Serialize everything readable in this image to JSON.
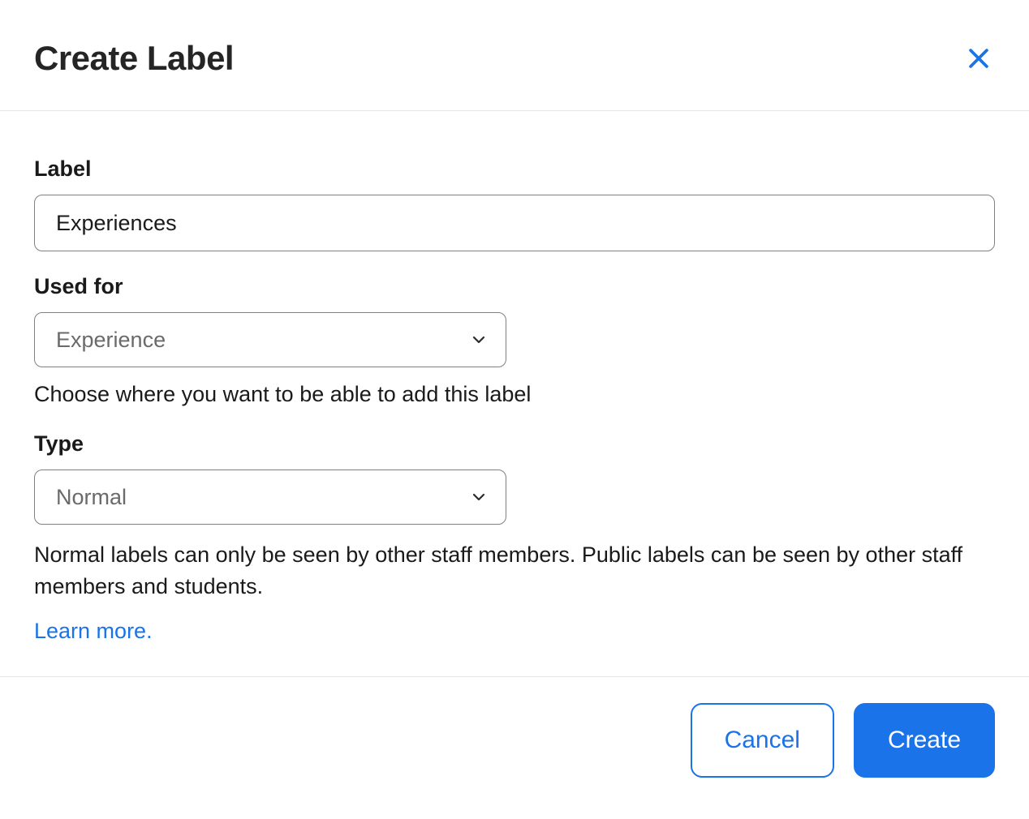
{
  "header": {
    "title": "Create Label"
  },
  "form": {
    "label_field": {
      "label": "Label",
      "value": "Experiences"
    },
    "used_for": {
      "label": "Used for",
      "selected": "Experience",
      "help": "Choose where you want to be able to add this label"
    },
    "type": {
      "label": "Type",
      "selected": "Normal",
      "help": "Normal labels can only be seen by other staff members. Public labels can be seen by other staff members and students.",
      "learn_more": "Learn more."
    }
  },
  "footer": {
    "cancel": "Cancel",
    "create": "Create"
  }
}
